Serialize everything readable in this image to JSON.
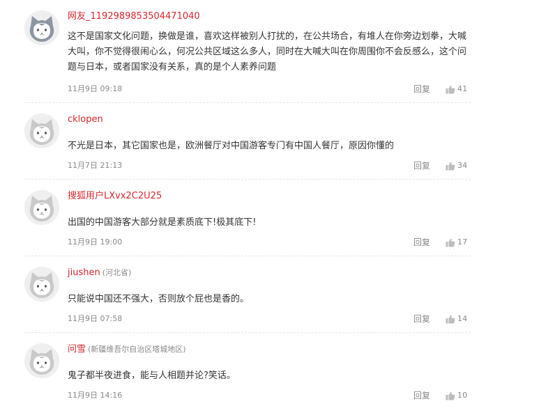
{
  "icons": {
    "avatar": "cat-avatar-icon",
    "like": "thumbs-up-icon"
  },
  "colors": {
    "username": "#d6272d",
    "meta": "#888888",
    "text": "#333333",
    "divider": "#e5e5e5"
  },
  "comments": [
    {
      "username": "网友_1192989853504471040",
      "location": "",
      "text": "这不是国家文化问题，换做是谁，喜欢这样被别人打扰的，在公共场合，有堆人在你旁边划拳，大喊大叫，你不觉得很闹心么，何况公共区域这么多人，同时在大喊大叫在你周围你不会反感么，这个问题与日本，或者国家没有关系，真的是个人素养问题",
      "time": "11月9日 09:18",
      "reply_label": "回复",
      "likes": "41"
    },
    {
      "username": "cklopen",
      "location": "",
      "text": "不光是日本，其它国家也是，欧洲餐厅对中国游客专门有中国人餐厅，原因你懂的",
      "time": "11月7日 21:13",
      "reply_label": "回复",
      "likes": "34"
    },
    {
      "username": "搜狐用户LXvx2C2U25",
      "location": "",
      "text": "出国的中国游客大部分就是素质底下!极其底下!",
      "time": "11月9日 19:00",
      "reply_label": "回复",
      "likes": "17"
    },
    {
      "username": "jiushen",
      "location": "(河北省)",
      "text": "只能说中国还不强大，否则放个屁也是香的。",
      "time": "11月9日 07:58",
      "reply_label": "回复",
      "likes": "14"
    },
    {
      "username": "问雪",
      "location": "(新疆维吾尔自治区塔城地区)",
      "text": "鬼子都半夜进食，能与人相题并论?笑话。",
      "time": "11月9日 14:16",
      "reply_label": "回复",
      "likes": "10"
    }
  ]
}
